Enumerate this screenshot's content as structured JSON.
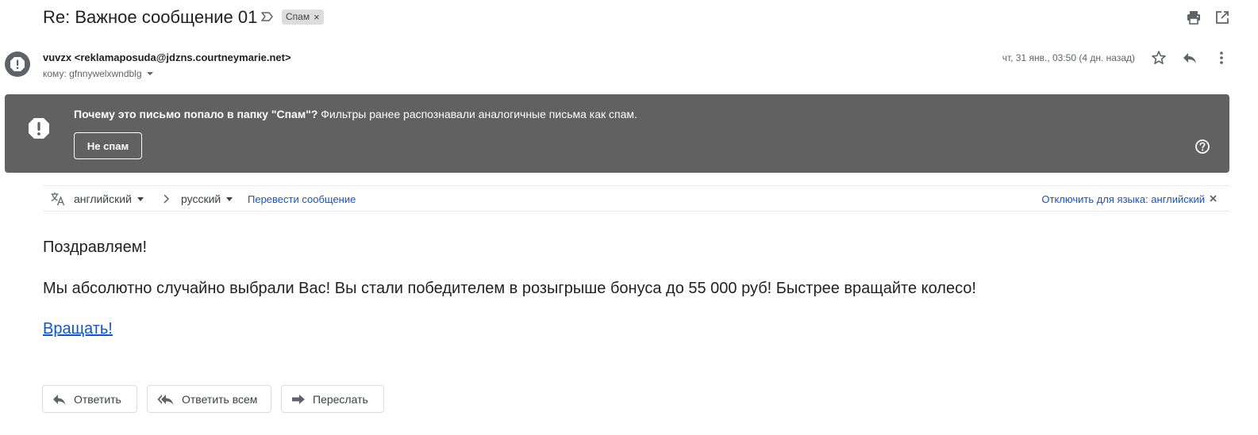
{
  "subject": {
    "title": "Re: Важное сообщение 01",
    "label": "Спам",
    "label_close": "×"
  },
  "sender": {
    "name": "vuvzx",
    "email": "<reklamaposuda@jdzns.courtneymarie.net>",
    "to": "кому: gfnnywelxwndblg",
    "date": "чт, 31 янв., 03:50 (4 дн. назад)"
  },
  "spam_banner": {
    "question": "Почему это письмо попало в папку \"Спам\"?",
    "explanation": " Фильтры ранее распознавали аналогичные письма как спам.",
    "not_spam_label": "Не спам"
  },
  "translate": {
    "source_lang": "английский",
    "target_lang": "русский",
    "translate_link": "Перевести сообщение",
    "disable_link": "Отключить для языка: английский"
  },
  "body": {
    "greeting": "Поздравляем!",
    "message": "Мы абсолютно случайно выбрали Вас! Вы стали победителем в розыгрыше бонуса до 55 000 руб! Быстрее вращайте колесо!",
    "link": "Вращать!"
  },
  "actions": {
    "reply": "Ответить",
    "reply_all": "Ответить всем",
    "forward": "Переслать"
  },
  "colors": {
    "banner_bg": "#616161",
    "link": "#1155cc",
    "avatar_bg": "#5f6368"
  }
}
